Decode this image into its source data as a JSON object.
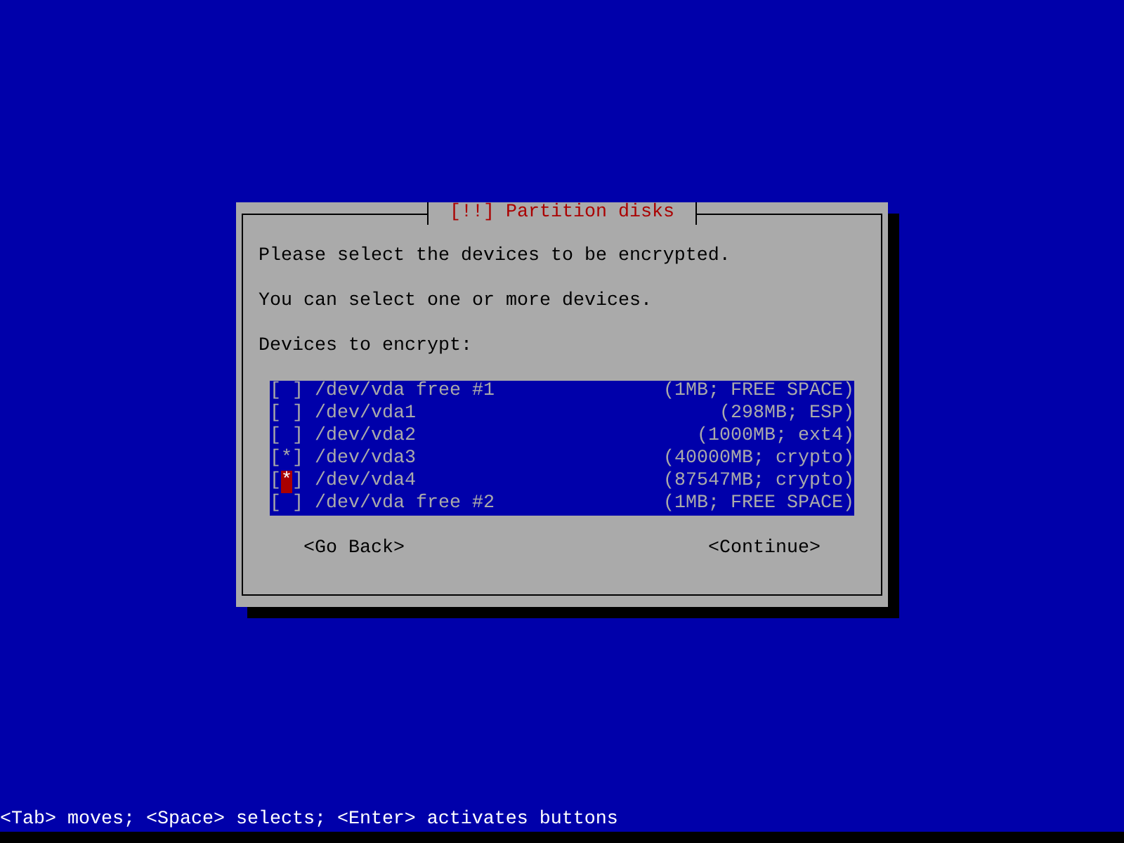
{
  "dialog": {
    "title": "[!!] Partition disks",
    "lines": [
      "Please select the devices to be encrypted.",
      "You can select one or more devices.",
      "Devices to encrypt:"
    ],
    "list": {
      "box_left": "[",
      "box_right": "]",
      "box_mark": "*",
      "items": [
        {
          "name": "/dev/vda free #1",
          "info": "(1MB; FREE SPACE)",
          "checked": false,
          "focused": false
        },
        {
          "name": "/dev/vda1",
          "info": "(298MB; ESP)",
          "checked": false,
          "focused": false
        },
        {
          "name": "/dev/vda2",
          "info": "(1000MB; ext4)",
          "checked": false,
          "focused": false
        },
        {
          "name": "/dev/vda3",
          "info": "(40000MB; crypto)",
          "checked": true,
          "focused": false
        },
        {
          "name": "/dev/vda4",
          "info": "(87547MB; crypto)",
          "checked": true,
          "focused": true
        },
        {
          "name": "/dev/vda free #2",
          "info": "(1MB; FREE SPACE)",
          "checked": false,
          "focused": false
        }
      ]
    },
    "buttons": [
      "<Go Back>",
      "<Continue>"
    ]
  },
  "status_bar": "<Tab> moves; <Space> selects; <Enter> activates buttons"
}
